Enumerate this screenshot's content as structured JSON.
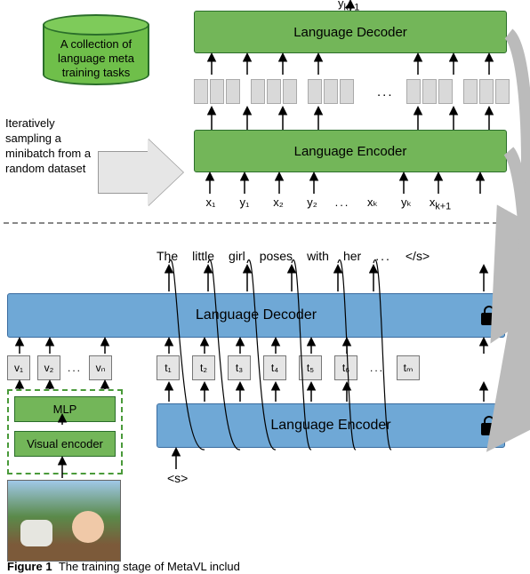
{
  "cylinder_label": "A collection of language meta training tasks",
  "side_text": "Iteratively sampling a minibatch from a random dataset",
  "top": {
    "decoder": "Language Decoder",
    "encoder": "Language Encoder",
    "y_output": "y",
    "y_output_sub": "k+1",
    "xy": [
      "x₁",
      "y₁",
      "x₂",
      "y₂",
      "...",
      "xₖ",
      "yₖ",
      "x"
    ],
    "xy_last_sub": "k+1"
  },
  "words": [
    "The",
    "little",
    "girl",
    "poses",
    "with",
    "her",
    "...",
    "</s>"
  ],
  "bot": {
    "decoder": "Language Decoder",
    "encoder": "Language Encoder"
  },
  "vboxes": [
    "v₁",
    "v₂",
    "...",
    "vₙ"
  ],
  "tboxes": [
    "t₁",
    "t₂",
    "t₃",
    "t₄",
    "t₅",
    "t₆",
    "...",
    "tₘ"
  ],
  "mlp": {
    "mlp": "MLP",
    "vis": "Visual encoder"
  },
  "s_token": "<s>",
  "caption": "Figure 1  The training stage of MetaVL includ"
}
